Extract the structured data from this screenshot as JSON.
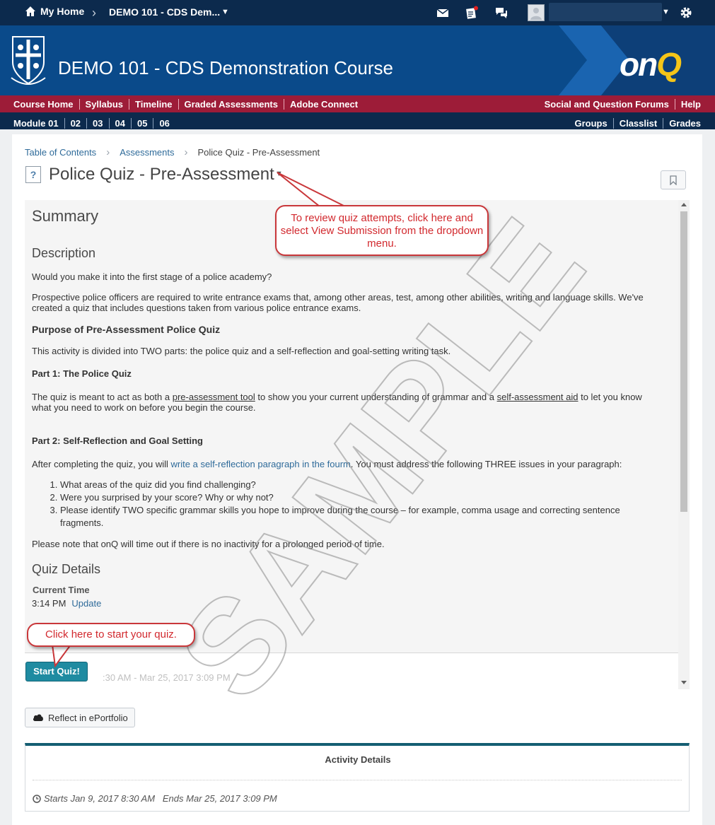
{
  "topbar": {
    "home_label": "My Home",
    "course_selector": "DEMO 101 - CDS Dem...",
    "icons": [
      "mail-icon",
      "assignment-alert-icon",
      "chat-icon",
      "avatar",
      "gear-icon"
    ]
  },
  "banner": {
    "course_title": "DEMO 101 - CDS Demonstration Course",
    "logo_text_prefix": "on",
    "logo_text_suffix": "Q",
    "accent_color": "#f5c518",
    "brand_color": "#0a4a8a"
  },
  "red_nav": {
    "left": [
      "Course Home",
      "Syllabus",
      "Timeline",
      "Graded Assessments",
      "Adobe Connect"
    ],
    "right": [
      "Social and Question Forums",
      "Help"
    ],
    "color": "#9d1c38"
  },
  "module_nav": {
    "left": [
      "Module 01",
      "02",
      "03",
      "04",
      "05",
      "06"
    ],
    "right": [
      "Groups",
      "Classlist",
      "Grades"
    ]
  },
  "breadcrumb": {
    "items": [
      "Table of Contents",
      "Assessments"
    ],
    "current": "Police Quiz - Pre-Assessment"
  },
  "page": {
    "title": "Police Quiz - Pre-Assessment",
    "title_icon": "?"
  },
  "content": {
    "summary_heading": "Summary",
    "description_heading": "Description",
    "p1": "Would you make it into the first stage of a police academy?",
    "p2": "Prospective police officers are required to write entrance exams that, among other areas, test, among other abilities, writing and language skills. We've created a quiz that includes questions taken from various police entrance exams.",
    "purpose_heading": "Purpose of Pre-Assessment Police Quiz",
    "p3": "This activity is divided into TWO parts: the police quiz and a self-reflection and goal-setting writing task.",
    "part1_heading": "Part 1: The Police Quiz",
    "p4_a": "The quiz is meant to act as both a ",
    "p4_link1": "pre-assessment tool",
    "p4_b": " to show you your current understanding of grammar and a ",
    "p4_link2": "self-assessment aid",
    "p4_c": " to let you know what you need to work on before you begin the course.",
    "part2_heading": "Part 2: Self-Reflection and Goal Setting",
    "p5_a": "After completing the quiz, you will ",
    "p5_link": "write a self-reflection paragraph in the fourm",
    "p5_b": ". You must address the following THREE issues in your paragraph:",
    "issues": [
      "What areas of the quiz did you find challenging?",
      "Were you surprised by your score? Why or why not?",
      "Please identify TWO specific grammar skills you hope to improve during the course – for example, comma usage and correcting sentence fragments."
    ],
    "p6": "Please note that onQ will time out if there is no inactivity for a prolonged period of time.",
    "quiz_details_heading": "Quiz Details",
    "current_time_label": "Current Time",
    "current_time": "3:14 PM",
    "update_link": "Update",
    "faded_dates": ":30 AM - Mar 25, 2017 3:09 PM"
  },
  "buttons": {
    "start_quiz": "Start Quiz!",
    "reflect": "Reflect in ePortfolio"
  },
  "activity": {
    "title": "Activity Details",
    "dates": "Starts Jan 9, 2017 8:30 AM   Ends Mar 25, 2017 3:09 PM"
  },
  "callouts": {
    "review": "To review quiz attempts, click here and select View Submission from the dropdown menu.",
    "start": "Click here to start your quiz."
  },
  "watermark": "SAMPLE"
}
